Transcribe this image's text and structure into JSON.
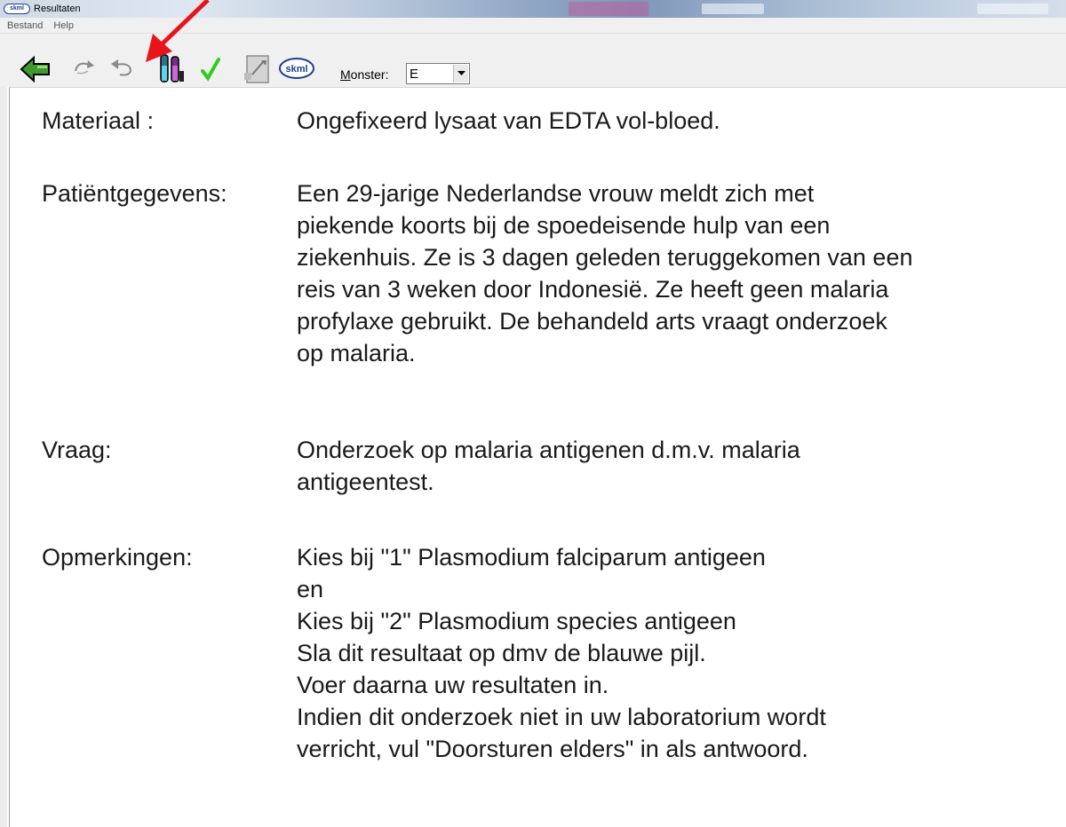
{
  "window": {
    "title": "Resultaten",
    "app_icon_text": "skml"
  },
  "menu": {
    "items": [
      "Bestand",
      "Help"
    ]
  },
  "toolbar": {
    "icons": [
      "back-arrow-icon",
      "redo-icon",
      "undo-icon",
      "test-tubes-icon",
      "checkmark-icon",
      "document-arrow-icon",
      "skml-logo-icon"
    ],
    "skml_text": "skml",
    "monster_label_prefix": "M",
    "monster_label_rest": "onster:",
    "monster_value": "E"
  },
  "content": {
    "materiaal": {
      "label": "Materiaal :",
      "lines": [
        "Ongefixeerd lysaat van EDTA vol-bloed."
      ]
    },
    "patient": {
      "label": "Patiëntgegevens:",
      "lines": [
        "Een 29-jarige Nederlandse vrouw meldt zich met",
        "piekende koorts bij de spoedeisende hulp van een",
        "ziekenhuis. Ze is 3 dagen geleden teruggekomen van een",
        "reis van 3 weken door Indonesië. Ze heeft geen malaria",
        "profylaxe gebruikt. De behandeld arts vraagt onderzoek",
        "op malaria."
      ]
    },
    "vraag": {
      "label": "Vraag:",
      "lines": [
        "Onderzoek op malaria antigenen d.m.v. malaria",
        "antigeentest."
      ]
    },
    "opmerkingen": {
      "label": "Opmerkingen:",
      "lines": [
        "Kies bij \"1\" Plasmodium falciparum antigeen",
        "en",
        "Kies bij \"2\" Plasmodium species antigeen",
        "Sla dit resultaat op dmv de blauwe pijl.",
        "Voer daarna uw resultaten in.",
        "Indien dit onderzoek niet in uw laboratorium wordt",
        "verricht, vul \"Doorsturen elders\" in als antwoord."
      ]
    }
  },
  "colors": {
    "annotation_arrow": "#e8141b",
    "toolbar_bg": "#f0f0f0"
  }
}
